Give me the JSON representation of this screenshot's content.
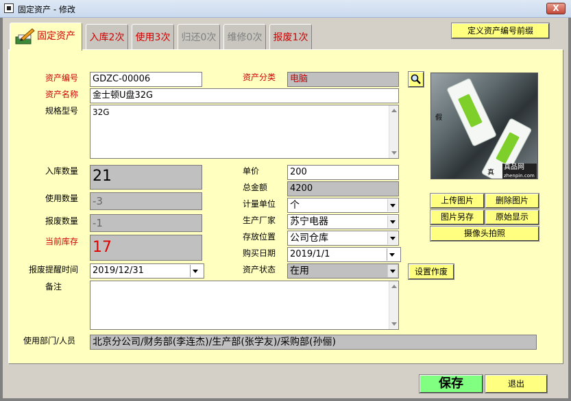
{
  "window": {
    "title": "固定资产 - 修改",
    "close_symbol": "X"
  },
  "tabs": [
    {
      "label": "固定资产"
    },
    {
      "label": "入库2次"
    },
    {
      "label": "使用3次"
    },
    {
      "label": "归还0次"
    },
    {
      "label": "维修0次"
    },
    {
      "label": "报废1次"
    }
  ],
  "define_prefix_button": "定义资产编号前缀",
  "form": {
    "asset_no_label": "资产编号",
    "asset_no": "GDZC-00006",
    "category_label": "资产分类",
    "category": "电脑",
    "name_label": "资产名称",
    "name": "金士顿U盘32G",
    "spec_label": "规格型号",
    "spec": "32G",
    "in_qty_label": "入库数量",
    "in_qty": "21",
    "use_qty_label": "使用数量",
    "use_qty": "-3",
    "scrap_qty_label": "报废数量",
    "scrap_qty": "-1",
    "stock_label": "当前库存",
    "stock": "17",
    "remind_label": "报废提醒时间",
    "remind": "2019/12/31",
    "note_label": "备注",
    "note": "",
    "price_label": "单价",
    "price": "200",
    "total_label": "总金额",
    "total": "4200",
    "unit_label": "计量单位",
    "unit": "个",
    "maker_label": "生产厂家",
    "maker": "苏宁电器",
    "location_label": "存放位置",
    "location": "公司仓库",
    "buy_date_label": "购买日期",
    "buy_date": "2019/1/1",
    "status_label": "资产状态",
    "status": "在用",
    "dept_label": "使用部门/人员",
    "dept": "北京分公司/财务部(李连杰)/生产部(张学友)/采购部(孙俪)"
  },
  "photo": {
    "text_fake": "假",
    "text_real": "真",
    "logo": "真品网",
    "logo_sub": "zhenpin.com"
  },
  "buttons": {
    "upload": "上传图片",
    "delete": "删除图片",
    "save_as": "图片另存",
    "original": "原始显示",
    "camera": "摄像头拍照",
    "set_void": "设置作废",
    "save": "保存",
    "exit": "退出"
  }
}
